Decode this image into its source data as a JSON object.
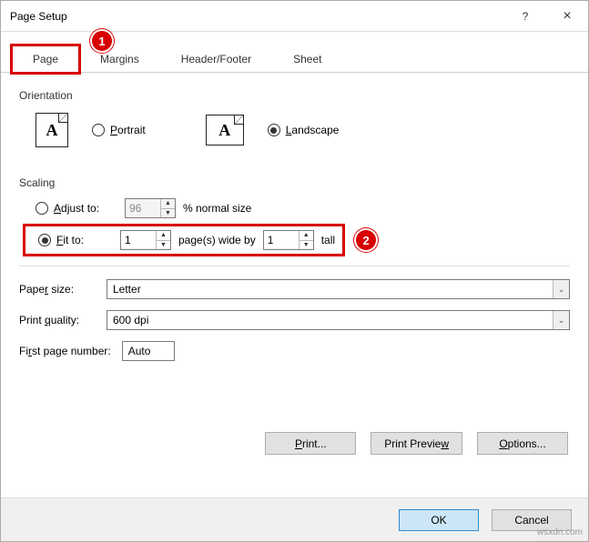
{
  "title": "Page Setup",
  "help_icon": "?",
  "close_icon": "×",
  "tabs": {
    "page": "Page",
    "margins": "Margins",
    "headerfooter": "Header/Footer",
    "sheet": "Sheet"
  },
  "orientation": {
    "label": "Orientation",
    "portrait": "Portrait",
    "landscape": "Landscape",
    "iconLetter": "A"
  },
  "scaling": {
    "label": "Scaling",
    "adjust": "Adjust to:",
    "adjust_value": "96",
    "adjust_suffix": "% normal size",
    "fit": "Fit to:",
    "fit_wide": "1",
    "fit_mid": "page(s) wide by",
    "fit_tall": "1",
    "fit_suffix": "tall"
  },
  "paper": {
    "label": "Paper size:",
    "value": "Letter"
  },
  "quality": {
    "label": "Print quality:",
    "value": "600 dpi"
  },
  "firstpage": {
    "label": "First page number:",
    "value": "Auto"
  },
  "buttons": {
    "print": "Print...",
    "preview": "Print Preview",
    "options": "Options...",
    "ok": "OK",
    "cancel": "Cancel"
  },
  "callouts": {
    "c1": "1",
    "c2": "2"
  },
  "watermark": "wsxdn.com"
}
